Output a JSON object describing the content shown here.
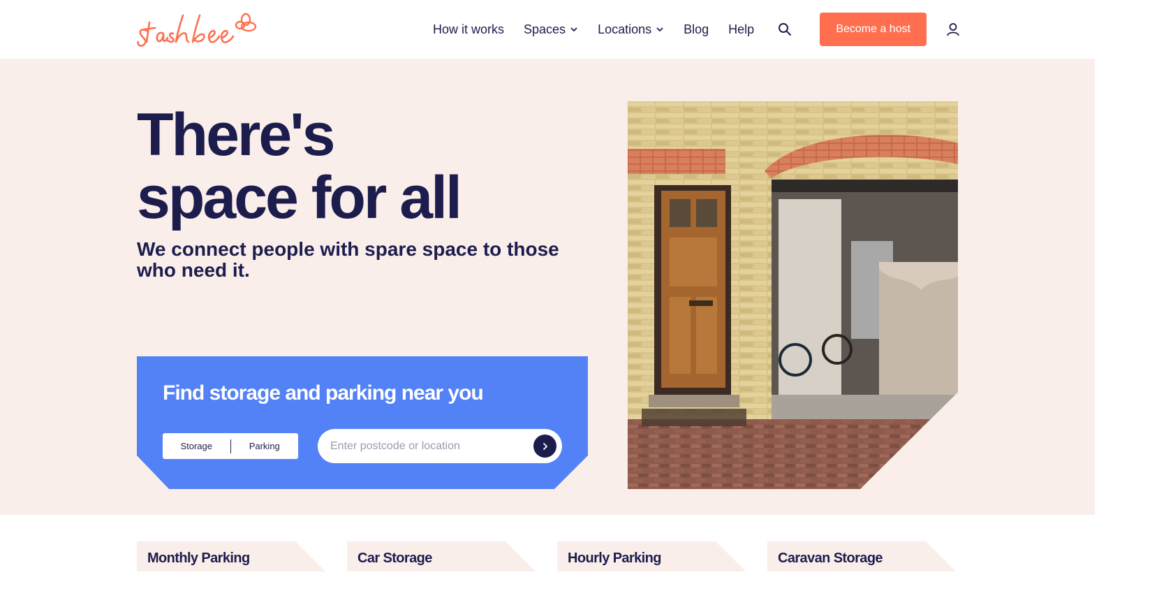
{
  "header": {
    "logo_text": "stashbee",
    "nav": [
      {
        "label": "How it works"
      },
      {
        "label": "Spaces"
      },
      {
        "label": "Locations"
      },
      {
        "label": "Blog"
      },
      {
        "label": "Help"
      }
    ],
    "search_icon": "search-icon",
    "host_button": "Become a host",
    "account_icon": "user-icon"
  },
  "hero": {
    "headline_line1": "There's",
    "headline_line2": "space for all",
    "subline": "We connect people with spare space to those who need it.",
    "search": {
      "title": "Find storage and parking near you",
      "toggle": [
        "Storage",
        "Parking"
      ],
      "placeholder": "Enter postcode or location",
      "go_icon": "chevron-right-icon"
    }
  },
  "categories": [
    {
      "label": "Monthly Parking"
    },
    {
      "label": "Car Storage"
    },
    {
      "label": "Hourly Parking"
    },
    {
      "label": "Caravan Storage"
    }
  ],
  "colors": {
    "navy": "#1c1d4d",
    "accent": "#ff6f4f",
    "hero_bg": "#faeeea",
    "search_card": "#5381f6"
  }
}
